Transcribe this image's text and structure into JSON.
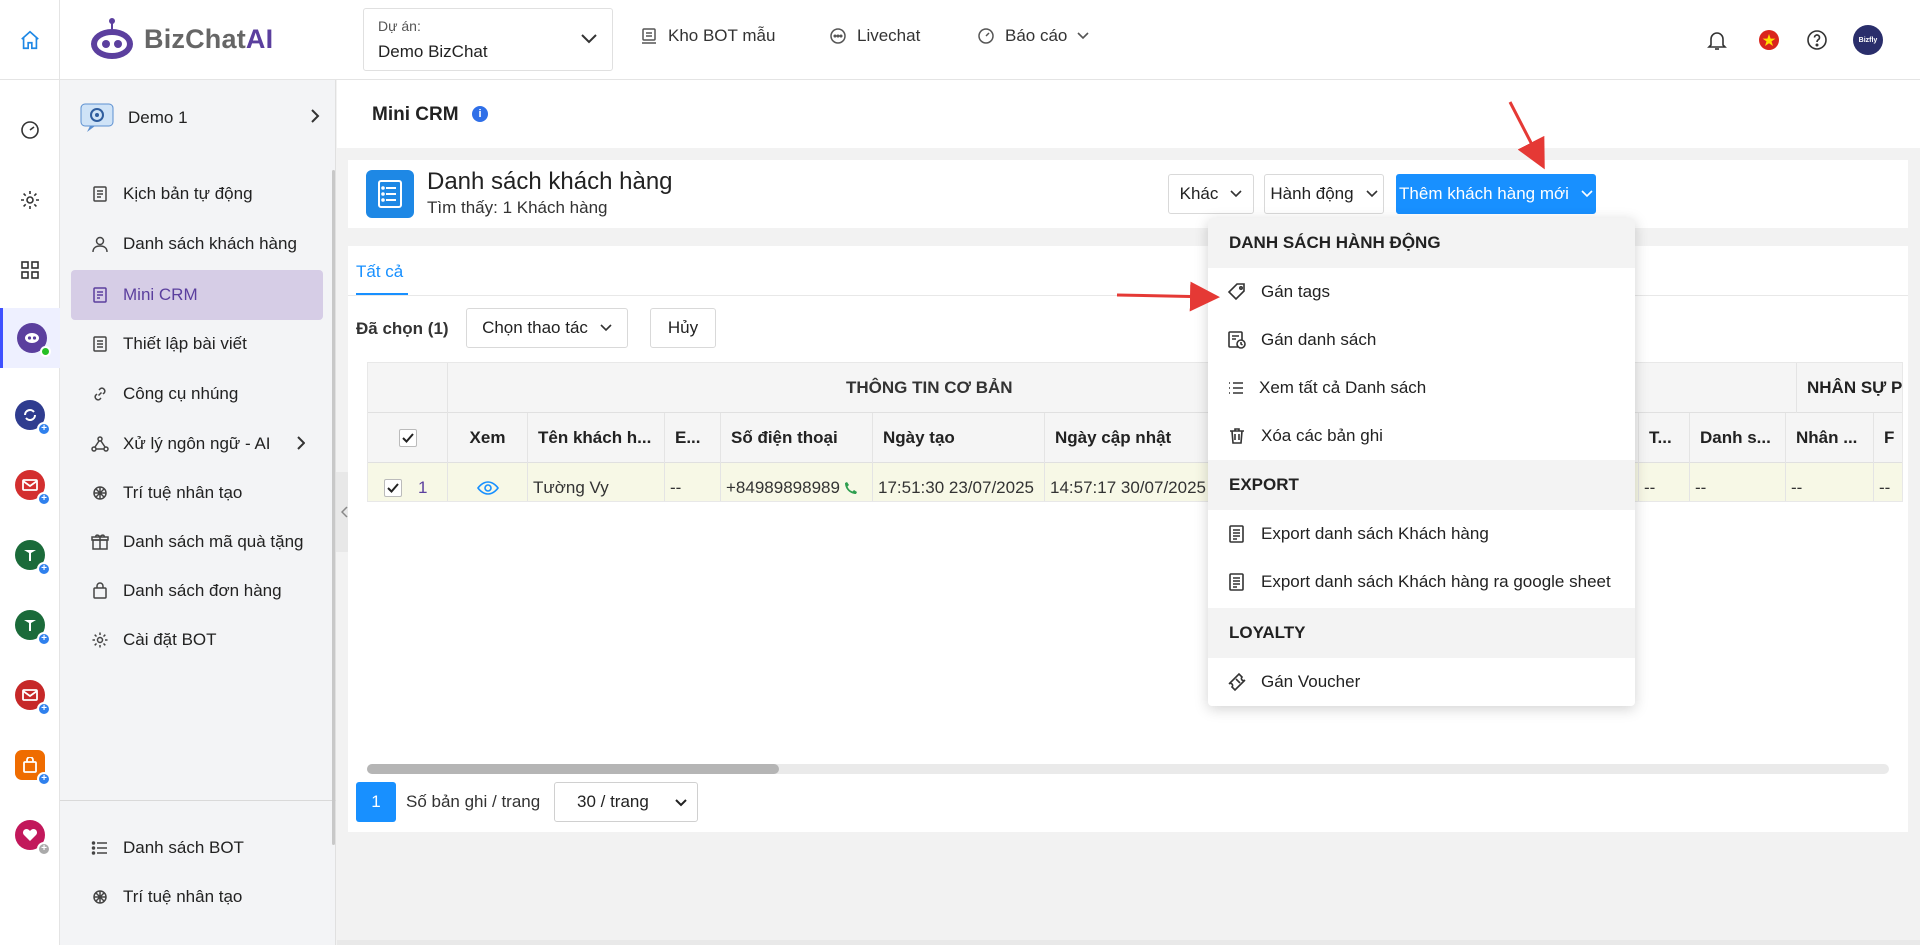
{
  "brand": {
    "name_part1": "BizChat",
    "name_part2": "AI"
  },
  "project": {
    "label": "Dự án:",
    "value": "Demo BizChat"
  },
  "topnav": {
    "kho_bot": "Kho BOT mẫu",
    "livechat": "Livechat",
    "bao_cao": "Báo cáo"
  },
  "avatar_text": "Bizfly",
  "sidebar": {
    "bot_name": "Demo 1",
    "items": [
      {
        "label": "Kịch bản tự động"
      },
      {
        "label": "Danh sách khách hàng"
      },
      {
        "label": "Mini CRM"
      },
      {
        "label": "Thiết lập bài viết"
      },
      {
        "label": "Công cụ nhúng"
      },
      {
        "label": "Xử lý ngôn ngữ - AI"
      },
      {
        "label": "Trí tuệ nhân tạo"
      },
      {
        "label": "Danh sách mã quà tặng"
      },
      {
        "label": "Danh sách đơn hàng"
      },
      {
        "label": "Cài đặt BOT"
      }
    ],
    "bottom_items": [
      {
        "label": "Danh sách BOT"
      },
      {
        "label": "Trí tuệ nhân tạo"
      }
    ]
  },
  "page": {
    "title": "Mini CRM",
    "info": "i"
  },
  "list": {
    "title": "Danh sách khách hàng",
    "subtitle": "Tìm thấy: 1 Khách hàng",
    "btn_khac": "Khác",
    "btn_hanh_dong": "Hành động",
    "btn_them": "Thêm khách hàng mới"
  },
  "tabs": {
    "all": "Tất cả"
  },
  "selection": {
    "label": "Đã chọn (1)",
    "action": "Chọn thao tác",
    "cancel": "Hủy"
  },
  "table": {
    "group_basic": "THÔNG TIN CƠ BẢN",
    "group_staff": "NHÂN SỰ PH",
    "headers": {
      "xem": "Xem",
      "ten": "Tên khách h...",
      "email": "E...",
      "sdt": "Số điện thoại",
      "ngay_tao": "Ngày tạo",
      "ngay_cap_nhat": "Ngày cập nhật",
      "t": "T...",
      "danh_sach": "Danh s...",
      "nhan_su": "Nhân ...",
      "f": "F"
    },
    "row": {
      "index": "1",
      "ten": "Tường Vy",
      "email": "--",
      "sdt": "+84989898989",
      "ngay_tao": "17:51:30 23/07/2025",
      "ngay_cap_nhat": "14:57:17 30/07/2025",
      "t": "--",
      "danh_sach": "--",
      "nhan_su": "--",
      "f": "--"
    }
  },
  "pagination": {
    "page": "1",
    "label": "Số bản ghi / trang",
    "per_page": "30 / trang"
  },
  "menu": {
    "section_actions": "DANH SÁCH HÀNH ĐỘNG",
    "gan_tags": "Gán tags",
    "gan_danh_sach": "Gán danh sách",
    "xem_tat_ca": "Xem tất cả Danh sách",
    "xoa": "Xóa các bản ghi",
    "section_export": "EXPORT",
    "export_kh": "Export danh sách Khách hàng",
    "export_gs": "Export danh sách Khách hàng ra google sheet",
    "section_loyalty": "LOYALTY",
    "gan_voucher": "Gán Voucher"
  },
  "colors": {
    "primary": "#1890ff",
    "brand_purple": "#5b3f9e",
    "active_bg": "#d6cde6",
    "annotation_red": "#e53935"
  }
}
